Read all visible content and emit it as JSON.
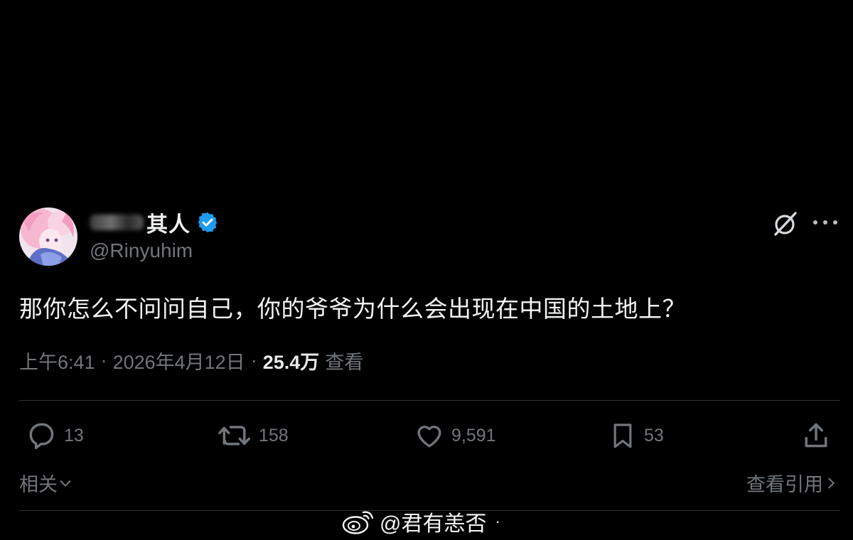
{
  "author": {
    "display_name": "其人",
    "handle": "@Rinyuhim",
    "verified": true
  },
  "post": {
    "text": "那你怎么不问问自己，你的爷爷为什么会出现在中国的土地上？",
    "time": "上午6:41",
    "date": "2026年4月12日",
    "separator": "·",
    "views_count": "25.4万",
    "views_label": "查看"
  },
  "actions": {
    "reply": "13",
    "repost": "158",
    "like": "9,591",
    "bookmark": "53"
  },
  "footer": {
    "related": "相关",
    "view_quotes": "查看引用"
  },
  "watermark": {
    "text": "@君有恙否",
    "dot": "·"
  },
  "colors": {
    "background": "#000000",
    "text": "#e7e9ea",
    "muted": "#71767b",
    "verified": "#1d9bf0",
    "divider": "#2f3336"
  },
  "icons": {
    "verified": "verified-badge-icon",
    "grok": "grok-icon",
    "more": "more-dots-icon",
    "reply": "reply-bubble-icon",
    "repost": "repost-arrows-icon",
    "like": "heart-icon",
    "bookmark": "bookmark-icon",
    "share": "share-upload-icon",
    "weibo": "weibo-logo-icon"
  }
}
